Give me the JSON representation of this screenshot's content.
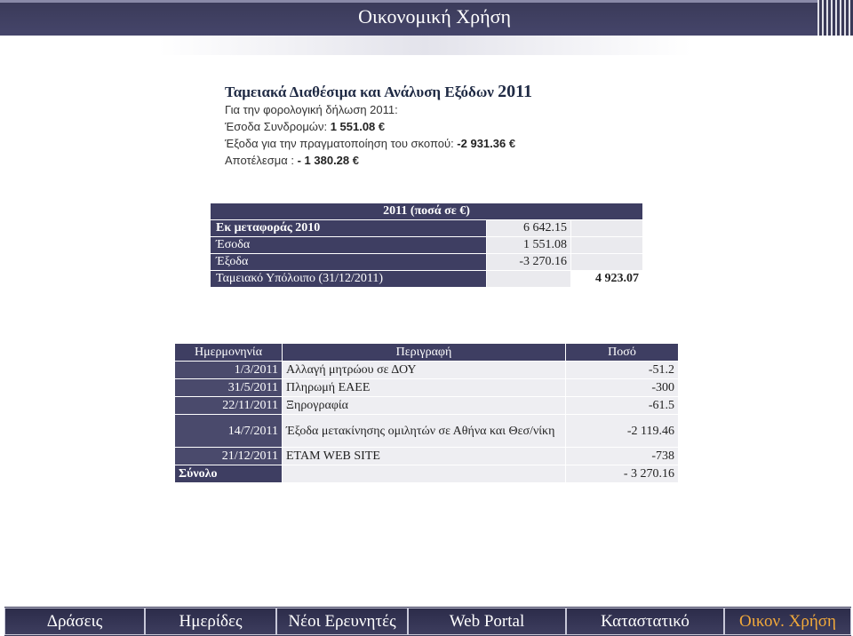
{
  "header": {
    "title": "Οικονομική Χρήση"
  },
  "heading": {
    "text": "Ταμειακά Διαθέσιμα και Ανάλυση Εξόδων ",
    "year": "2011"
  },
  "info": {
    "line1": "Για την φορολογική δήλωση 2011:",
    "line2_label": "Έσοδα Συνδρομών: ",
    "line2_value": "1 551.08",
    "line3_label": "Έξοδα για την πραγματοποίηση του σκοπού: ",
    "line3_value": "-2 931.36",
    "line4_label": "Αποτέλεσμα : ",
    "line4_value": "- 1 380.28",
    "currency": "€"
  },
  "summary": {
    "header": "2011 (ποσά σε €)",
    "rows": [
      {
        "label": "Εκ μεταφοράς 2010",
        "value": "6 642.15"
      },
      {
        "label": "Έσοδα",
        "value": "1 551.08"
      },
      {
        "label": "Έξοδα",
        "value": "-3 270.16"
      }
    ],
    "balance_label": "Ταμειακό Υπόλοιπο (31/12/2011)",
    "balance_value": "4 923.07"
  },
  "expenses": {
    "columns": [
      "Ημερμονηνία",
      "Περιγραφή",
      "Ποσό"
    ],
    "rows": [
      {
        "date": "1/3/2011",
        "desc": "Αλλαγή μητρώου σε ΔΟΥ",
        "amount": "-51.2"
      },
      {
        "date": "31/5/2011",
        "desc": "Πληρωμή ΕΑΕΕ",
        "amount": "-300"
      },
      {
        "date": "22/11/2011",
        "desc": "Ξηρογραφία",
        "amount": "-61.5"
      },
      {
        "date": "14/7/2011",
        "desc": "Έξοδα μετακίνησης ομιλητών σε Αθήνα και Θεσ/νίκη",
        "amount": "-2 119.46"
      },
      {
        "date": "21/12/2011",
        "desc": "ETAM WEB SITE",
        "amount": "-738"
      }
    ],
    "total_label": "Σύνολο",
    "total_value": "- 3 270.16"
  },
  "nav": {
    "items": [
      "Δράσεις",
      "Ημερίδες",
      "Νέοι Ερευνητές",
      "Web Portal",
      "Καταστατικό",
      "Οικον. Χρήση"
    ],
    "active_color": "#f2a93a"
  }
}
